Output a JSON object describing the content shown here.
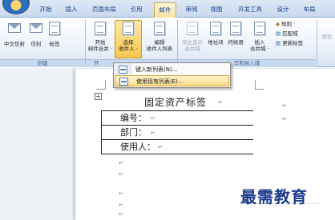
{
  "tabs": [
    {
      "label": "开始"
    },
    {
      "label": "插入"
    },
    {
      "label": "页面布局"
    },
    {
      "label": "引用"
    },
    {
      "label": "邮件"
    },
    {
      "label": "审阅"
    },
    {
      "label": "视图"
    },
    {
      "label": "开发工具"
    },
    {
      "label": "设计"
    },
    {
      "label": "布局"
    }
  ],
  "active_tab": "邮件",
  "ribbon": {
    "groups": {
      "create": "创建",
      "start": "开",
      "write_insert": "写和插入域"
    },
    "buttons": {
      "chinese_envelope": "中文信封",
      "envelope": "信封",
      "label": "标签",
      "start_merge_1": "开始",
      "start_merge_2": "邮件合并 ·",
      "select_recipients_1": "选择",
      "select_recipients_2": "收件人 ·",
      "edit_recipients_1": "编辑",
      "edit_recipients_2": "收件人列表",
      "highlight_1": "突出显示",
      "highlight_2": "合并域",
      "address_block": "地址块",
      "greeting": "问候语",
      "insert_1": "插入",
      "insert_2": "合并域 ·",
      "rules": "规则 ·",
      "match_fields": "匹配域",
      "update_labels": "更新标签",
      "preview": "预览"
    }
  },
  "menu": {
    "items": [
      {
        "label": "键入新列表(N)..."
      },
      {
        "label": "使用现有列表(E)..."
      }
    ]
  },
  "document": {
    "title": "固定资产标签",
    "fields": [
      {
        "label": "编号："
      },
      {
        "label": "部门："
      },
      {
        "label": "使用人："
      }
    ],
    "para_mark": "↵"
  },
  "watermark": "最需教育"
}
